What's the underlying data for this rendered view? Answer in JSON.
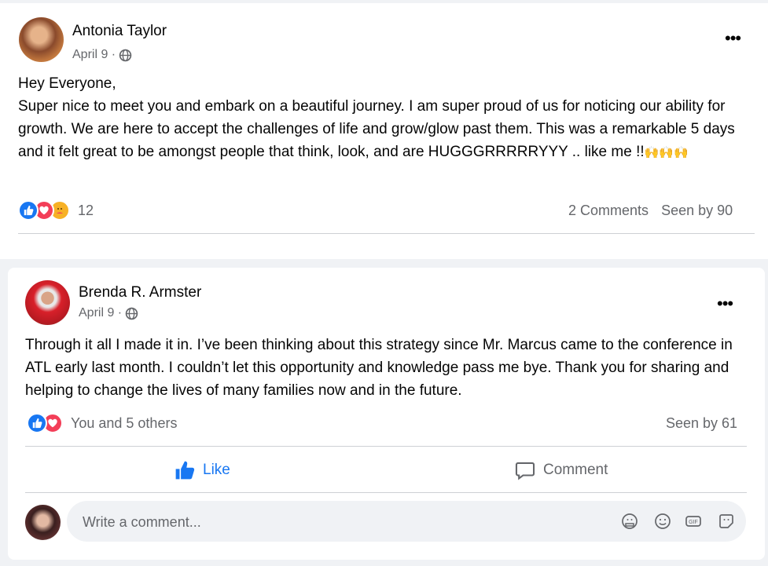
{
  "posts": [
    {
      "author": "Antonia Taylor",
      "date": "April 9 · ",
      "privacy_icon": "globe-icon",
      "body": "Hey Everyone,\nSuper nice to meet you and embark on a beautiful journey. I am super proud of us for noticing our ability for growth. We are here to accept the challenges of life and grow/glow past them. This was a remarkable 5 days and it felt great to be amongst people that think, look, and are HUGGGRRRRRYYY .. like me !!",
      "emoji_tail": "🙌🙌🙌",
      "reactions": [
        "like",
        "love",
        "care"
      ],
      "reaction_count": "12",
      "comments": "2 Comments",
      "seen": "Seen by 90"
    },
    {
      "author": "Brenda R. Armster",
      "date": "April 9 · ",
      "privacy_icon": "globe-icon",
      "body": "Through it all I made it in. I’ve been thinking about this strategy since Mr. Marcus came to the conference in ATL early last month. I couldn’t let this opportunity and knowledge pass me bye. Thank you for sharing and helping to change the lives of many families now and in the future.",
      "reactions": [
        "like",
        "love"
      ],
      "reaction_text": "You and 5 others",
      "seen": "Seen by 61",
      "actions": {
        "like": "Like",
        "comment": "Comment"
      },
      "comment_placeholder": "Write a comment..."
    }
  ],
  "colors": {
    "like_blue": "#1877f2",
    "love_red": "#f33e58",
    "care_yellow": "#f7b125"
  }
}
